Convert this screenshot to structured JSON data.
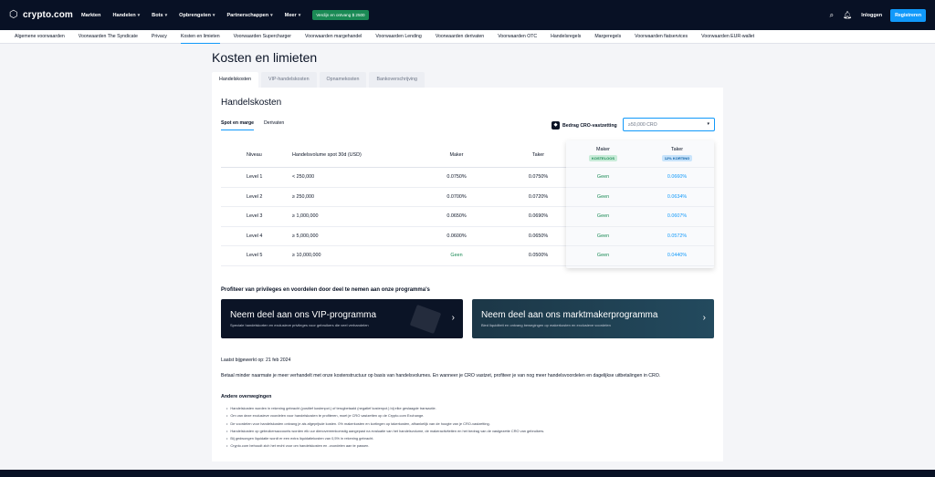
{
  "header": {
    "brand": "crypto.com",
    "nav": [
      {
        "label": "Markten",
        "chevron": false
      },
      {
        "label": "Handelen",
        "chevron": true
      },
      {
        "label": "Bots",
        "chevron": true
      },
      {
        "label": "Opbrengsten",
        "chevron": true
      },
      {
        "label": "Partnerschappen",
        "chevron": true
      },
      {
        "label": "Meer",
        "chevron": true
      }
    ],
    "promo": "Verdijn en ontvang $ 2500",
    "login": "Inloggen",
    "register": "Registreren"
  },
  "subnav": [
    "Algemene voorwaarden",
    "Voorwaarden The Syndicate",
    "Privacy",
    "Kosten en limieten",
    "Voorwaarden Supercharger",
    "Voorwaarden margehandel",
    "Voorwaarden Lending",
    "Voorwaarden derivaten",
    "Voorwaarden OTC",
    "Handelsregels",
    "Margeregels",
    "Voorwaarden fiatservices",
    "Voorwaarden EUR-wallet"
  ],
  "subnav_active": "Kosten en limieten",
  "page_title": "Kosten en limieten",
  "tabs": [
    "Handelskosten",
    "VIP-handelskosten",
    "Opnamekosten",
    "Bankoverschrijving"
  ],
  "card": {
    "title": "Handelskosten",
    "subtabs": [
      "Spot en marge",
      "Derivaten"
    ],
    "cro_label": "Bedrag CRO-vastzetting",
    "cro_value": "≥50,000 CRO",
    "table": {
      "headers": [
        "Niveau",
        "Handelsvolume spot 30d (USD)",
        "Maker",
        "Taker"
      ],
      "rows": [
        {
          "level": "Level 1",
          "volume": "< 250,000",
          "maker": "0.0750%",
          "taker": "0.0750%",
          "maker_green": false
        },
        {
          "level": "Level 2",
          "volume": "≥ 250,000",
          "maker": "0.0700%",
          "taker": "0.0720%",
          "maker_green": false
        },
        {
          "level": "Level 3",
          "volume": "≥ 1,000,000",
          "maker": "0.0650%",
          "taker": "0.0690%",
          "maker_green": false
        },
        {
          "level": "Level 4",
          "volume": "≥ 5,000,000",
          "maker": "0.0600%",
          "taker": "0.0650%",
          "maker_green": false
        },
        {
          "level": "Level 5",
          "volume": "≥ 10,000,000",
          "maker": "Geen",
          "taker": "0.0500%",
          "maker_green": true
        }
      ]
    },
    "highlight": {
      "maker_label": "Maker",
      "maker_badge": "KOSTELOOS",
      "taker_label": "Taker",
      "taker_badge": "12% KORTING",
      "rows": [
        {
          "maker": "Geen",
          "taker": "0.0660%"
        },
        {
          "maker": "Geen",
          "taker": "0.0634%"
        },
        {
          "maker": "Geen",
          "taker": "0.0607%"
        },
        {
          "maker": "Geen",
          "taker": "0.0572%"
        },
        {
          "maker": "Geen",
          "taker": "0.0440%"
        }
      ]
    },
    "promo_title": "Profiteer van privileges en voordelen door deel te nemen aan onze programma's",
    "vip": {
      "title": "Neem deel aan ons VIP-programma",
      "sub": "Speciale handelskorten en exclusieve privileges voor gebruikers die veel verhandelen"
    },
    "mm": {
      "title": "Neem deel aan ons marktmakerprogramma",
      "sub": "Bied liquiditeit en ontvang bewegingen op makerkosten en exclusieve voordelen"
    },
    "updated": "Laatst bijgewerkt op: 21 feb 2024",
    "desc": "Betaal minder naarmate je meer verhandelt met onze kostenstructuur op basis van handelsvolumes. En wanneer je CRO vastzet, profiteer je van nog meer handelsvoordelen en dagelijkse uitbetalingen in CRO.",
    "other_title": "Andere overwegingen",
    "notes": [
      "Handelskosten worden in rekening gebracht (positief kostenpct.) of terugbetaald (negatief kostenpct.) bij elke geslaagde transactie.",
      "Om van deze exclusieve voordelen voor handelskosten te profiteren, moet je CRO vastzetten op de Crypto.com Exchange.",
      "De voordelen voor handelskosten ontvang je als afgeprijsde kosten. 0% makerkosten en kortingen op takerkosten, afhankelijk van de hoogte van je CRO-vastzetting.",
      "Handelskosten op gebruikersaccounts worden elk uur dienovereenkomstig aangepast na evaluatie van het handelsvolume, de makeractiviteiten en het bedrag van de vastgezette CRO van gebruikers.",
      "Bij gedwongen liquidatie wordt er een extra liquidatiekosten van 0,5% in rekening gebracht.",
      "Crypto.com behoudt zich het recht voor om handelskosten en -voordelen aan te passen."
    ]
  }
}
